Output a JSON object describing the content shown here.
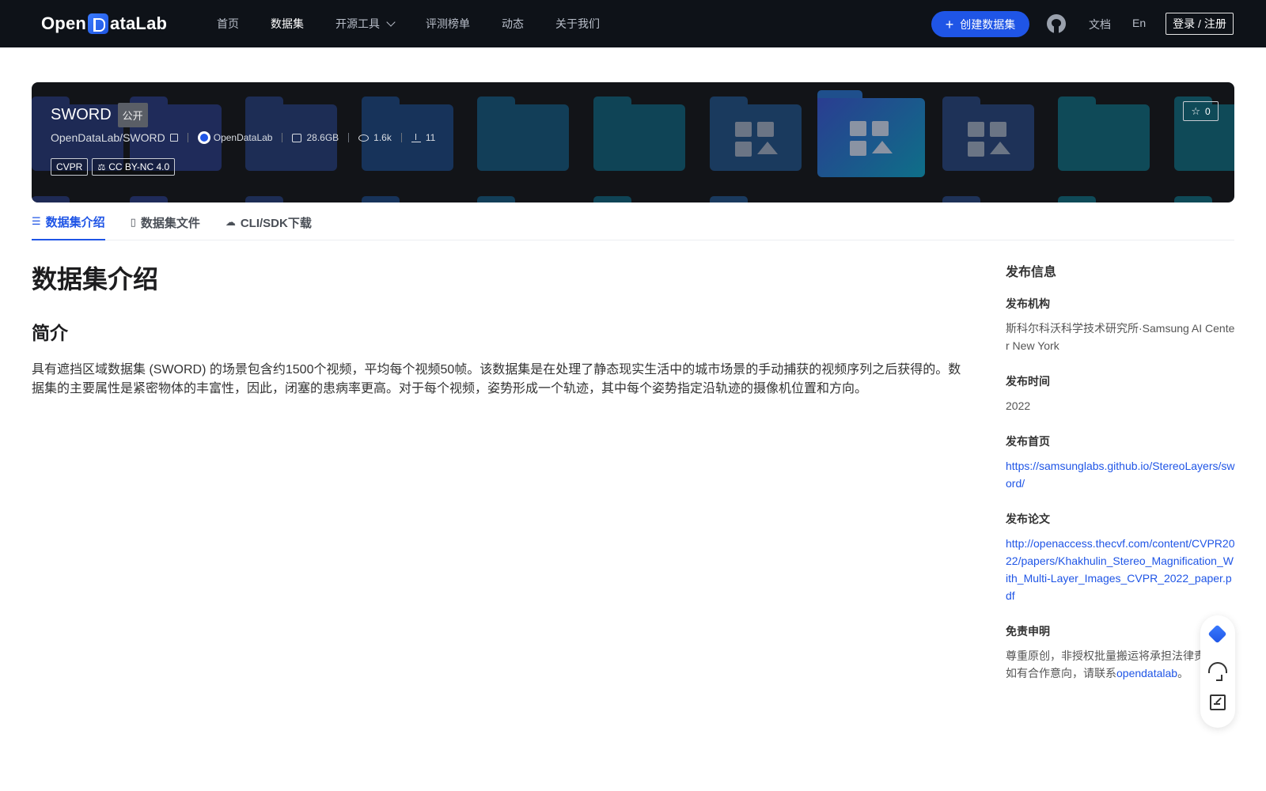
{
  "topbar": {
    "logo_text": "OpenDataLab",
    "nav": [
      {
        "label": "首页"
      },
      {
        "label": "数据集"
      },
      {
        "label": "开源工具"
      },
      {
        "label": "评测榜单"
      },
      {
        "label": "动态"
      },
      {
        "label": "关于我们"
      }
    ],
    "create_label": "创建数据集",
    "docs_label": "文档",
    "lang_label": "En",
    "login_label": "登录 / 注册"
  },
  "banner": {
    "title": "SWORD",
    "visibility": "公开",
    "repo": "OpenDataLab/SWORD",
    "org": "OpenDataLab",
    "size": "28.6GB",
    "views": "1.6k",
    "downloads": "11",
    "tags": [
      "CVPR",
      "CC BY-NC 4.0"
    ],
    "stars": "0"
  },
  "tabs": [
    {
      "label": "数据集介绍"
    },
    {
      "label": "数据集文件"
    },
    {
      "label": "CLI/SDK下载"
    }
  ],
  "main": {
    "title": "数据集介绍",
    "section_title": "简介",
    "description": "具有遮挡区域数据集 (SWORD) 的场景包含约1500个视频，平均每个视频50帧。该数据集是在处理了静态现实生活中的城市场景的手动捕获的视频序列之后获得的。数据集的主要属性是紧密物体的丰富性，因此，闭塞的患病率更高。对于每个视频，姿势形成一个轨迹，其中每个姿势指定沿轨迹的摄像机位置和方向。"
  },
  "side": {
    "heading": "发布信息",
    "org_label": "发布机构",
    "org_value": "斯科尔科沃科学技术研究所·Samsung AI Center New York",
    "time_label": "发布时间",
    "time_value": "2022",
    "homepage_label": "发布首页",
    "homepage_value": "https://samsunglabs.github.io/StereoLayers/sword/",
    "paper_label": "发布论文",
    "paper_value": "http://openaccess.thecvf.com/content/CVPR2022/papers/Khakhulin_Stereo_Magnification_With_Multi-Layer_Images_CVPR_2022_paper.pdf",
    "disclaimer_label": "免责申明",
    "disclaimer_line1": "尊重原创，非授权批量搬运将承担法律责任。",
    "disclaimer_line2_prefix": "如有合作意向，请联系",
    "disclaimer_link": "opendatalab",
    "disclaimer_suffix": "。"
  },
  "colors": {
    "accent": "#1f55e6",
    "topbar_bg": "#0e1218",
    "banner_bg": "#121418"
  },
  "icons": [
    "github-icon",
    "plus-icon",
    "copy-icon",
    "disk-icon",
    "eye-icon",
    "download-icon",
    "star-icon",
    "license-icon",
    "database-icon",
    "file-icon",
    "cloud-icon",
    "diamond-icon",
    "headset-icon",
    "edit-icon"
  ]
}
